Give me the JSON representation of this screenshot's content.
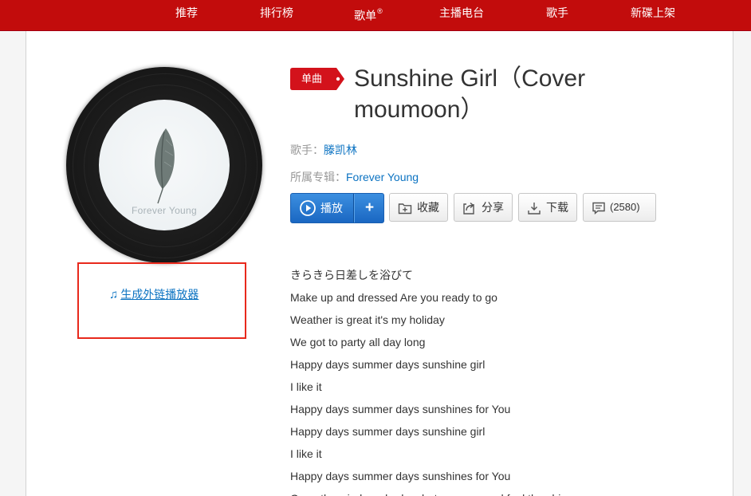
{
  "nav": {
    "items": [
      "推荐",
      "排行榜",
      "歌单",
      "主播电台",
      "歌手",
      "新碟上架"
    ],
    "playlist_mark": "®"
  },
  "song": {
    "type_badge": "单曲",
    "title": "Sunshine Girl（Cover moumoon）",
    "artist_label": "歌手：",
    "artist": "滕凯林",
    "album_label": "所属专辑：",
    "album": "Forever Young",
    "cover_text": "Forever Young"
  },
  "actions": {
    "play": "播放",
    "add": "+",
    "collect": "收藏",
    "share": "分享",
    "download": "下载",
    "comment": "(2580)"
  },
  "generate_player_link": "生成外链播放器",
  "lyrics": [
    "きらきら日差しを浴びて",
    "Make up and dressed Are you ready to go",
    "Weather is great it's my holiday",
    "We got to party all day long",
    "Happy days summer days sunshine girl",
    "I like it",
    "Happy days summer days sunshines for You",
    "Happy days summer days sunshine girl",
    "I like it",
    "Happy days summer days sunshines for You",
    "Open the window shade, shut my eyes and feel the shine"
  ],
  "colors": {
    "nav_bg": "#c20c0c",
    "link": "#0c73c2",
    "play_blue": "#1a67c2",
    "badge_red": "#d3121b",
    "highlight_box": "#e8291c"
  }
}
